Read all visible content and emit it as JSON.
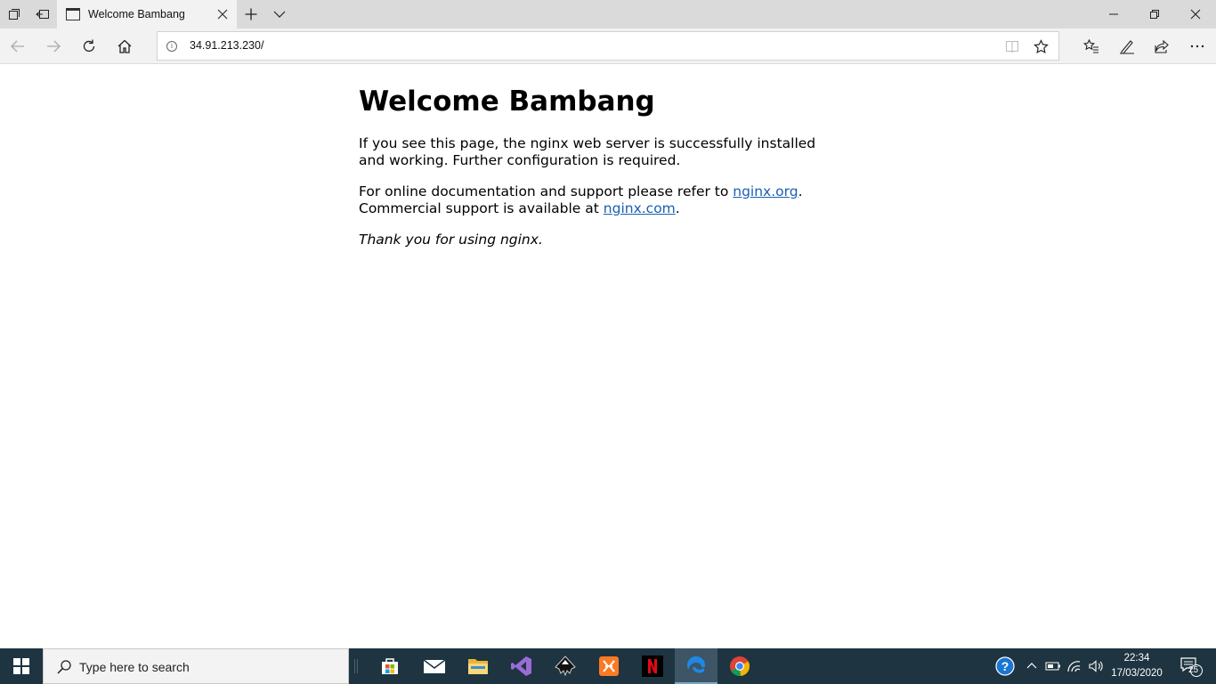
{
  "browser": {
    "tab": {
      "title": "Welcome Bambang"
    },
    "address": {
      "url": "34.91.213.230/"
    }
  },
  "page": {
    "heading": "Welcome Bambang",
    "para1": "If you see this page, the nginx web server is successfully installed and working. Further configuration is required.",
    "para2_prefix": "For online documentation and support please refer to ",
    "link1": "nginx.org",
    "para2_mid": ".",
    "para2_line2": "Commercial support is available at ",
    "link2": "nginx.com",
    "para2_end": ".",
    "thanks": "Thank you for using nginx."
  },
  "taskbar": {
    "search_placeholder": "Type here to search",
    "apps": [
      "store-icon",
      "mail-icon",
      "file-explorer-icon",
      "visual-studio-icon",
      "inkscape-icon",
      "xampp-icon",
      "netflix-icon",
      "edge-icon",
      "chrome-icon"
    ],
    "time": "22:34",
    "date": "17/03/2020",
    "notification_count": "25"
  },
  "colors": {
    "link": "#1a5fb4",
    "taskbar": "#1e3441",
    "titlebar": "#dadada"
  }
}
